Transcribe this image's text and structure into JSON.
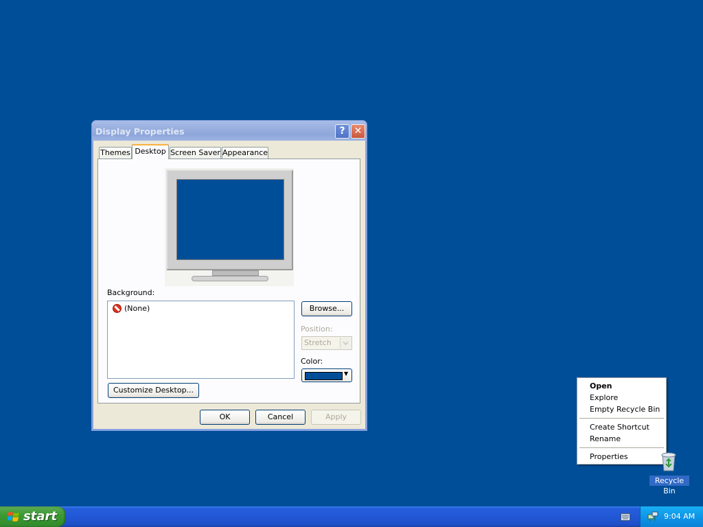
{
  "dialog": {
    "title": "Display Properties",
    "help_symbol": "?",
    "close_symbol": "✕",
    "tabs": [
      "Themes",
      "Desktop",
      "Screen Saver",
      "Appearance"
    ],
    "active_tab": "Desktop",
    "background_label": "Background:",
    "background_items": [
      "(None)"
    ],
    "browse_label": "Browse...",
    "position_label": "Position:",
    "position_value": "Stretch",
    "color_label": "Color:",
    "color_value": "#004e98",
    "customize_label": "Customize Desktop...",
    "ok_label": "OK",
    "cancel_label": "Cancel",
    "apply_label": "Apply"
  },
  "context_menu": {
    "items": [
      "Open",
      "Explore",
      "Empty Recycle Bin",
      "Create Shortcut",
      "Rename",
      "Properties"
    ],
    "default_item": "Open"
  },
  "desktop": {
    "background_color": "#004e98",
    "recycle_bin_label": "Recycle Bin"
  },
  "taskbar": {
    "start_label": "start",
    "clock": "9:04 AM"
  }
}
